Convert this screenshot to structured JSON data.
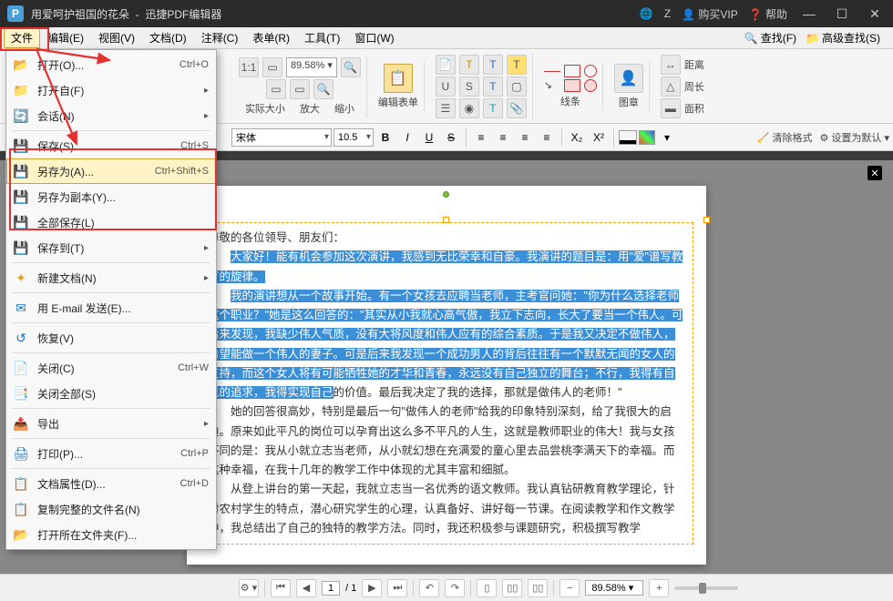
{
  "titlebar": {
    "logo_letter": "P",
    "doc_title": "用爱呵护祖国的花朵",
    "app_name": "迅捷PDF编辑器",
    "user_initial": "Z",
    "buy_vip": "购买VIP",
    "help": "帮助"
  },
  "menubar": {
    "items": [
      "文件",
      "编辑(E)",
      "视图(V)",
      "文档(D)",
      "注释(C)",
      "表单(R)",
      "工具(T)",
      "窗口(W)"
    ],
    "search": "查找(F)",
    "adv_search": "高级查找(S)"
  },
  "ribbon": {
    "zoom_value": "89.58%",
    "actual_size": "实际大小",
    "zoom_in": "放大",
    "zoom_out": "缩小",
    "edit_form": "编辑表单",
    "lines": "线条",
    "image": "图章",
    "distance": "距离",
    "perimeter": "周长",
    "area": "面积"
  },
  "fmtbar": {
    "font_name": "宋体",
    "font_size": "10.5",
    "clear_format": "清除格式",
    "set_default": "设置为默认"
  },
  "document": {
    "greeting": "尊敬的各位领导、朋友们：",
    "p1": "大家好！能有机会参加这次演讲，我感到无比荣幸和自豪。我演讲的题目是：用\"爱\"谱写教育的旋律。",
    "p2a": "我的演讲想从一个故事开始。有一个女孩去应聘当老师，主考官问她：\"你为什么选择老师这个职业？\"她是这么回答的：\"其实从小我就心高气傲，我立下志向，长大了要当一个伟人。可后来发现，我缺少伟人气质，没有大将风度和伟人应有的综合素质。于是我又决定不做伟人，希望能做一个伟人的妻子。可是后来我发现一个成功男人的背后往往有一个默默无闻的女人的支持，而这个女人将有可能牺牲她的才华和青春，永远没有自己独立的舞台；不行，我得有自己的追求，我得实现自己",
    "p2b": "的价值。最后我决定了我的选择，那就是做伟人的老师！\"",
    "p3": "她的回答很高妙，特别是最后一句\"做伟人的老师\"给我的印象特别深刻，给了我很大的启迪。原来如此平凡的岗位可以孕育出这么多不平凡的人生，这就是教师职业的伟大！我与女孩不同的是：我从小就立志当老师，从小就幻想在充满爱的童心里去品尝桃李满天下的幸福。而这种幸福，在我十几年的教学工作中体现的尤其丰富和细腻。",
    "p4": "从登上讲台的第一天起，我就立志当一名优秀的语文教师。我认真钻研教育教学理论，针对农村学生的特点，潜心研究学生的心理，认真备好、讲好每一节课。在阅读教学和作文教学中，我总结出了自己的独特的教学方法。同时，我还积极参与课题研究，积极撰写教学"
  },
  "statusbar": {
    "page_current": "1",
    "page_total": "/ 1",
    "zoom": "89.58%"
  },
  "filemenu": {
    "open": "打开(O)...",
    "open_sc": "Ctrl+O",
    "open_from": "打开自(F)",
    "session": "会话(N)",
    "save": "保存(S)",
    "save_sc": "Ctrl+S",
    "save_as": "另存为(A)...",
    "save_as_sc": "Ctrl+Shift+S",
    "save_copy": "另存为副本(Y)...",
    "save_all": "全部保存(L)",
    "save_to": "保存到(T)",
    "new_doc": "新建文档(N)",
    "email": "用 E-mail 发送(E)...",
    "revert": "恢复(V)",
    "close": "关闭(C)",
    "close_sc": "Ctrl+W",
    "close_all": "关闭全部(S)",
    "export": "导出",
    "print": "打印(P)...",
    "print_sc": "Ctrl+P",
    "doc_props": "文档属性(D)...",
    "doc_props_sc": "Ctrl+D",
    "copy_name": "复制完整的文件名(N)",
    "open_folder": "打开所在文件夹(F)..."
  }
}
